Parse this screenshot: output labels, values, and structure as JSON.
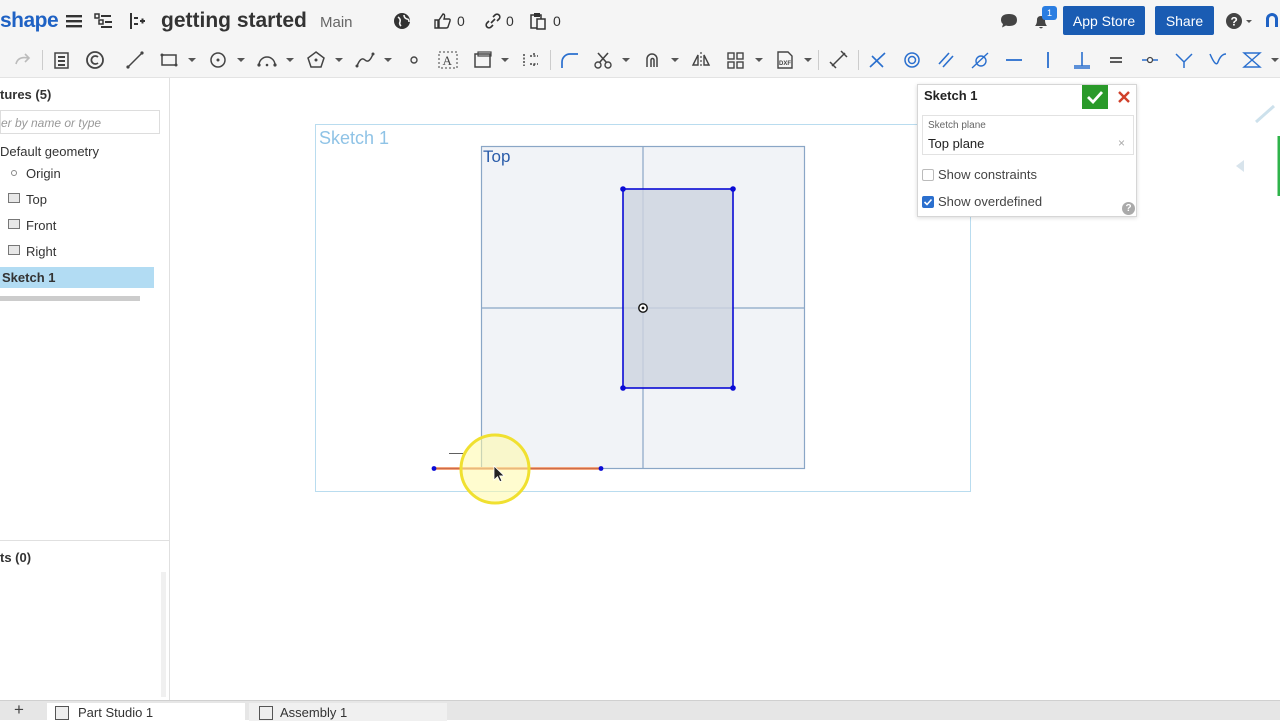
{
  "header": {
    "logo": "shape",
    "doc_title": "getting started",
    "branch": "Main",
    "likes_count": "0",
    "links_count": "0",
    "copies_count": "0",
    "notifications_count": "1",
    "app_store_label": "App Store",
    "share_label": "Share",
    "help_icon": "help-icon"
  },
  "left_panel": {
    "features_header": "tures (5)",
    "filter_placeholder": "er by name or type",
    "items": [
      {
        "label": "Default geometry"
      },
      {
        "label": "Origin"
      },
      {
        "label": "Top"
      },
      {
        "label": "Front"
      },
      {
        "label": "Right"
      },
      {
        "label": "Sketch 1"
      }
    ],
    "parts_header": "ts (0)"
  },
  "bottom_tabs": {
    "add": "+",
    "tabs": [
      {
        "label": "Part Studio 1"
      },
      {
        "label": "Assembly 1"
      }
    ]
  },
  "dialog": {
    "title": "Sketch 1",
    "field_label": "Sketch plane",
    "field_value": "Top plane",
    "clear": "×",
    "show_constraints": "Show constraints",
    "show_overdefined": "Show overdefined",
    "show_constraints_checked": false,
    "show_overdefined_checked": true,
    "help": "?"
  },
  "canvas": {
    "sketch_label": "Sketch 1",
    "plane_label": "Top",
    "cursor_hint": "—"
  },
  "colors": {
    "brand": "#1f62c4",
    "sketch_line": "#0000dd",
    "highlight": "#f2a37c",
    "ok_green": "#2a9a2a",
    "cancel_red": "#d0402a"
  }
}
